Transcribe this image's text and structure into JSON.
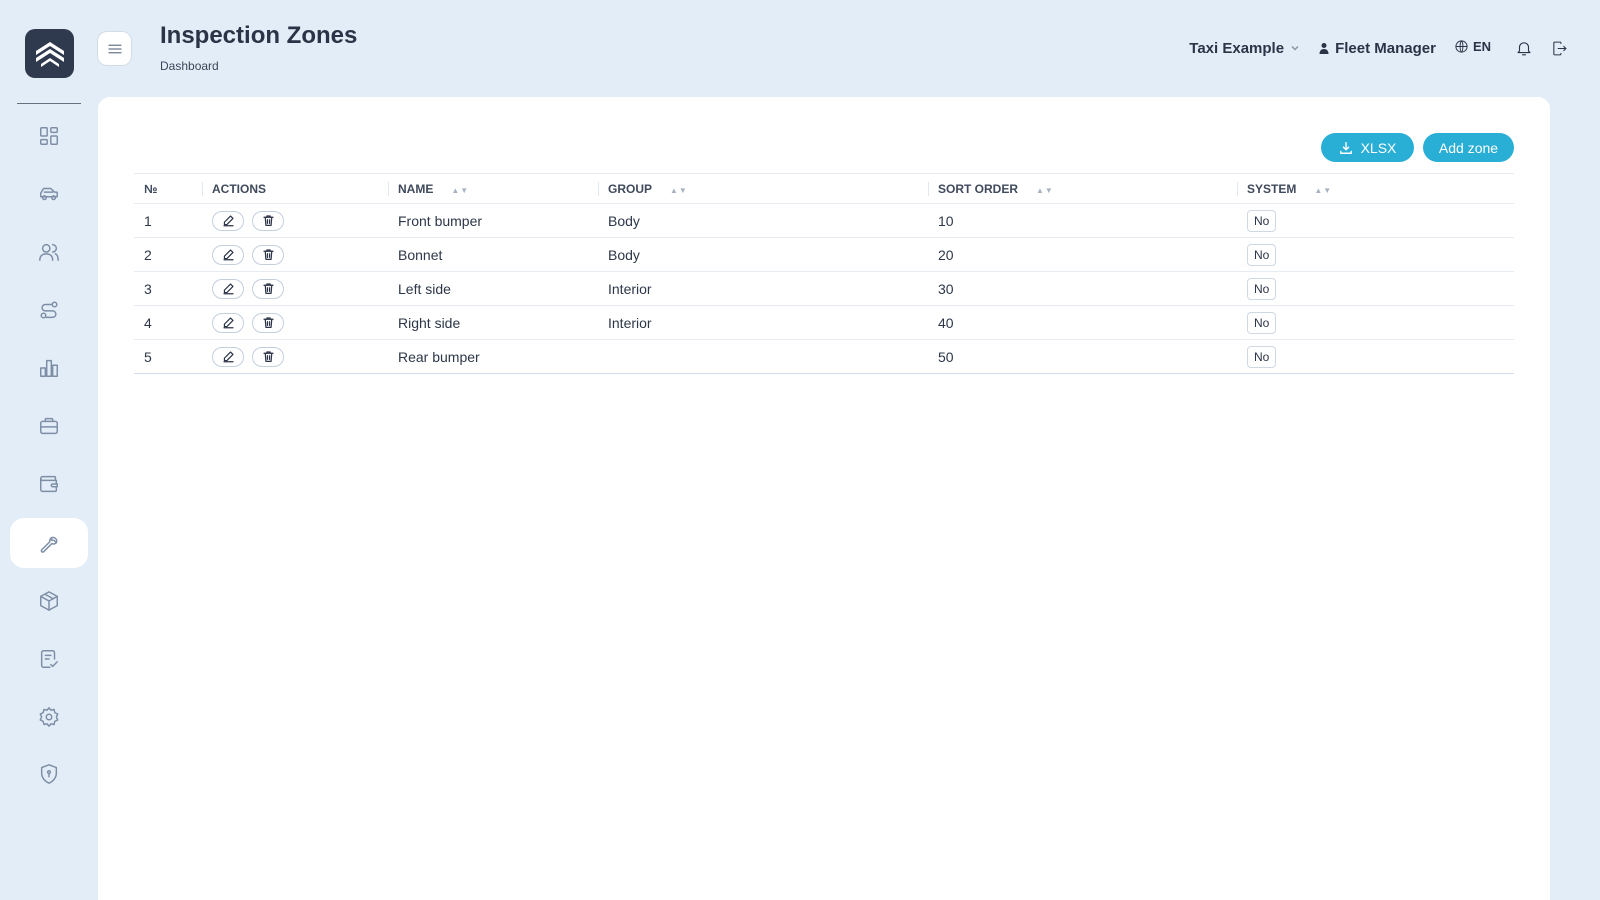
{
  "header": {
    "title": "Inspection Zones",
    "breadcrumb": "Dashboard",
    "company": "Taxi Example",
    "user": "Fleet Manager",
    "language": "EN"
  },
  "sidebar": {
    "items": [
      {
        "icon": "dashboard-icon",
        "active": false
      },
      {
        "icon": "car-icon",
        "active": false
      },
      {
        "icon": "users-icon",
        "active": false
      },
      {
        "icon": "route-icon",
        "active": false
      },
      {
        "icon": "bar-chart-icon",
        "active": false
      },
      {
        "icon": "briefcase-icon",
        "active": false
      },
      {
        "icon": "wallet-icon",
        "active": false
      },
      {
        "icon": "wrench-icon",
        "active": true
      },
      {
        "icon": "package-icon",
        "active": false
      },
      {
        "icon": "checklist-icon",
        "active": false
      },
      {
        "icon": "settings-icon",
        "active": false
      },
      {
        "icon": "shield-icon",
        "active": false
      }
    ]
  },
  "toolbar": {
    "export_label": "XLSX",
    "add_label": "Add zone"
  },
  "table": {
    "columns": {
      "num": "№",
      "actions": "ACTIONS",
      "name": "NAME",
      "group": "GROUP",
      "sort_order": "SORT ORDER",
      "system": "SYSTEM"
    },
    "rows": [
      {
        "num": "1",
        "name": "Front bumper",
        "group": "Body",
        "sort_order": "10",
        "system": "No"
      },
      {
        "num": "2",
        "name": "Bonnet",
        "group": "Body",
        "sort_order": "20",
        "system": "No"
      },
      {
        "num": "3",
        "name": "Left side",
        "group": "Interior",
        "sort_order": "30",
        "system": "No"
      },
      {
        "num": "4",
        "name": "Right side",
        "group": "Interior",
        "sort_order": "40",
        "system": "No"
      },
      {
        "num": "5",
        "name": "Rear bumper",
        "group": "",
        "sort_order": "50",
        "system": "No"
      }
    ]
  },
  "colors": {
    "background": "#e3edf7",
    "accent": "#29aed6",
    "logo_bg": "#2f3a4e"
  }
}
